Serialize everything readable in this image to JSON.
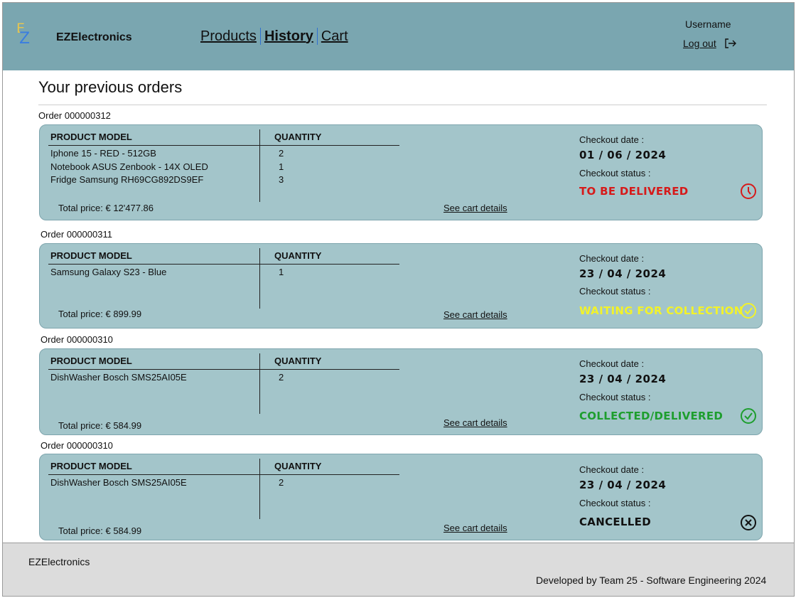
{
  "header": {
    "logo_letters": [
      "E",
      "Z"
    ],
    "brand": "EZElectronics",
    "nav": [
      {
        "label": "Products",
        "active": false
      },
      {
        "label": "History",
        "active": true
      },
      {
        "label": "Cart",
        "active": false
      }
    ],
    "username": "Username",
    "logout_label": "Log out"
  },
  "page": {
    "title": "Your previous orders"
  },
  "orders": [
    {
      "label": "Order 000000312",
      "col_product": "PRODUCT MODEL",
      "col_quantity": "QUANTITY",
      "products": [
        "Iphone 15 - RED - 512GB",
        "Notebook ASUS Zenbook - 14X OLED",
        "Fridge Samsung RH69CG892DS9EF"
      ],
      "quantities": [
        "2",
        "1",
        "3"
      ],
      "total": "Total price: € 12'477.86",
      "details_label": "See cart details",
      "checkout_date_label": "Checkout date :",
      "checkout_date": "01 / 06 / 2024",
      "checkout_status_label": "Checkout status :",
      "status": "TO BE DELIVERED",
      "status_color": "#d61a1a",
      "status_icon": "clock-icon"
    },
    {
      "label": "Order 000000311",
      "col_product": "PRODUCT MODEL",
      "col_quantity": "QUANTITY",
      "products": [
        "Samsung Galaxy S23 - Blue"
      ],
      "quantities": [
        "1"
      ],
      "total": "Total price: € 899.99",
      "details_label": "See cart details",
      "checkout_date_label": "Checkout date :",
      "checkout_date": "23 / 04 / 2024",
      "checkout_status_label": "Checkout status :",
      "status": "WAITING FOR COLLECTION",
      "status_color": "#f2f22a",
      "status_icon": "check-circle-icon"
    },
    {
      "label": "Order 000000310",
      "col_product": "PRODUCT MODEL",
      "col_quantity": "QUANTITY",
      "products": [
        "DishWasher Bosch SMS25AI05E"
      ],
      "quantities": [
        "2"
      ],
      "total": "Total price: € 584.99",
      "details_label": "See cart details",
      "checkout_date_label": "Checkout date :",
      "checkout_date": "23 / 04 / 2024",
      "checkout_status_label": "Checkout status :",
      "status": "COLLECTED/DELIVERED",
      "status_color": "#1e9e2e",
      "status_icon": "check-circle-icon"
    },
    {
      "label": "Order 000000310",
      "col_product": "PRODUCT MODEL",
      "col_quantity": "QUANTITY",
      "products": [
        "DishWasher Bosch SMS25AI05E"
      ],
      "quantities": [
        "2"
      ],
      "total": "Total price: € 584.99",
      "details_label": "See cart details",
      "checkout_date_label": "Checkout date :",
      "checkout_date": "23 / 04 / 2024",
      "checkout_status_label": "Checkout status :",
      "status": "CANCELLED",
      "status_color": "#111111",
      "status_icon": "cancel-circle-icon"
    }
  ],
  "footer": {
    "brand": "EZElectronics",
    "credit": "Developed by Team 25 - Software Engineering 2024"
  }
}
